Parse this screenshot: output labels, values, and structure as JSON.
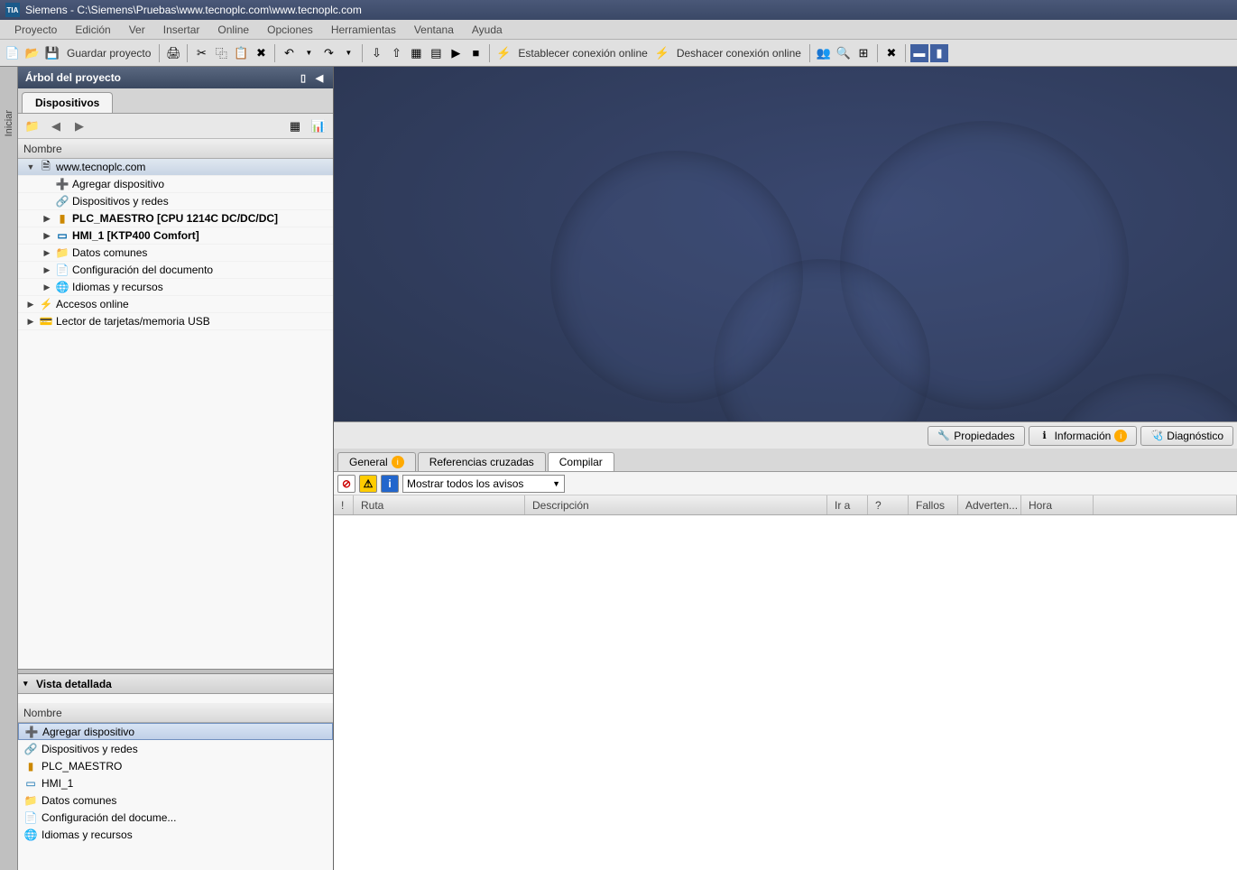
{
  "title": "Siemens  -  C:\\Siemens\\Pruebas\\www.tecnoplc.com\\www.tecnoplc.com",
  "menu": {
    "proyecto": "Proyecto",
    "edicion": "Edición",
    "ver": "Ver",
    "insertar": "Insertar",
    "online": "Online",
    "opciones": "Opciones",
    "herramientas": "Herramientas",
    "ventana": "Ventana",
    "ayuda": "Ayuda"
  },
  "toolbar": {
    "guardar": "Guardar proyecto",
    "online": "Establecer conexión online",
    "offline": "Deshacer conexión online"
  },
  "sidetab": "Iniciar",
  "project_tree": {
    "title": "Árbol del proyecto",
    "tab": "Dispositivos",
    "col": "Nombre",
    "nodes": {
      "root": "www.tecnoplc.com",
      "agregar": "Agregar dispositivo",
      "dispred": "Dispositivos y redes",
      "plc": "PLC_MAESTRO [CPU 1214C DC/DC/DC]",
      "hmi": "HMI_1 [KTP400 Comfort]",
      "datos": "Datos comunes",
      "confdoc": "Configuración del documento",
      "idiomas": "Idiomas y recursos",
      "accesos": "Accesos online",
      "lector": "Lector de tarjetas/memoria USB"
    }
  },
  "detail": {
    "title": "Vista detallada",
    "col": "Nombre",
    "rows": {
      "agregar": "Agregar dispositivo",
      "dispred": "Dispositivos y redes",
      "plc": "PLC_MAESTRO",
      "hmi": "HMI_1",
      "datos": "Datos comunes",
      "confdoc": "Configuración del docume...",
      "idiomas": "Idiomas y recursos"
    }
  },
  "infotabs": {
    "prop": "Propiedades",
    "info": "Información",
    "diag": "Diagnóstico"
  },
  "bottom_tabs": {
    "general": "General",
    "ref": "Referencias cruzadas",
    "compilar": "Compilar"
  },
  "filter": {
    "selected": "Mostrar todos los avisos"
  },
  "msgcols": {
    "bang": "!",
    "ruta": "Ruta",
    "desc": "Descripción",
    "ira": "Ir a",
    "q": "?",
    "fallos": "Fallos",
    "adv": "Adverten...",
    "hora": "Hora"
  }
}
